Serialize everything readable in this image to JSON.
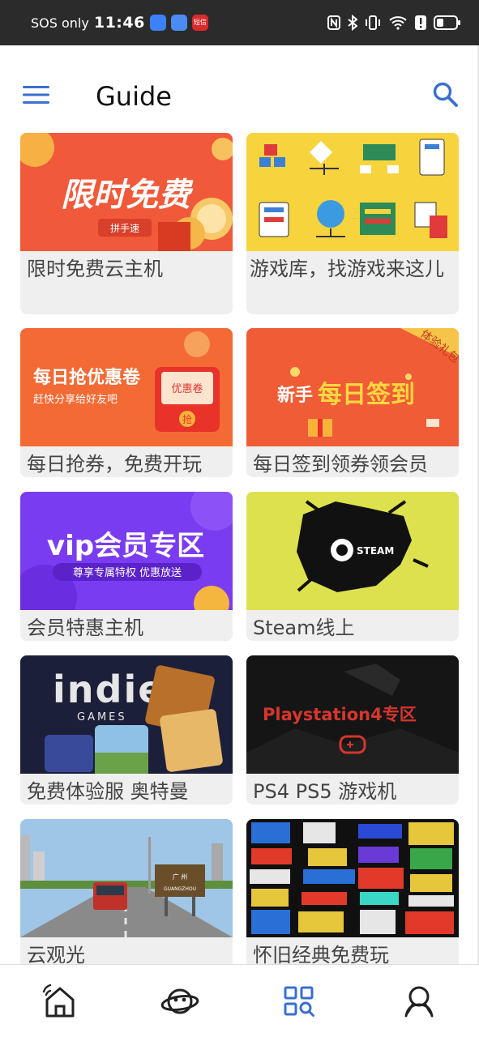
{
  "status_bar": {
    "carrier": "SOS only",
    "time": "11:46",
    "app_badge_label": "短信"
  },
  "header": {
    "title": "Guide",
    "menu_icon": "hamburger-menu-icon",
    "search_icon": "search-icon"
  },
  "cards": [
    {
      "label": "限时免费云主机",
      "banner": "限时免费",
      "badge": "拼手速"
    },
    {
      "label": "游戏库，找游戏来这儿"
    },
    {
      "label": "每日抢券，免费开玩",
      "banner": "每日抢优惠卷",
      "sub": "赶快分享给好友吧",
      "coupon": "优惠卷",
      "grab": "抢"
    },
    {
      "label": "每日签到领券领会员",
      "banner_a": "新手",
      "banner_b": "每日签到",
      "ribbon": "体验礼包"
    },
    {
      "label": "会员特惠主机",
      "banner": "vip会员专区",
      "sub": "尊享专属特权 优惠放送"
    },
    {
      "label": "Steam线上",
      "banner": "STEAM"
    },
    {
      "label": "免费体验服 奥特曼",
      "banner": "indie",
      "sub": "GAMES"
    },
    {
      "label": "PS4 PS5 游戏机",
      "banner": "Playstation4专区"
    },
    {
      "label": "云观光",
      "sign_a": "广 州",
      "sign_b": "GUANGZHOU"
    },
    {
      "label": "怀旧经典免费玩"
    }
  ],
  "bottom_nav": [
    {
      "name": "home",
      "icon": "home-icon",
      "color": "#222222"
    },
    {
      "name": "discover",
      "icon": "planet-icon",
      "color": "#222222"
    },
    {
      "name": "guide",
      "icon": "grid-search-icon",
      "color": "#3a6fd0",
      "active": true
    },
    {
      "name": "profile",
      "icon": "user-icon",
      "color": "#222222"
    }
  ],
  "colors": {
    "accent": "#3a6fd0",
    "card_bg": "#efefef",
    "status_bar": "#2b2b2b"
  }
}
